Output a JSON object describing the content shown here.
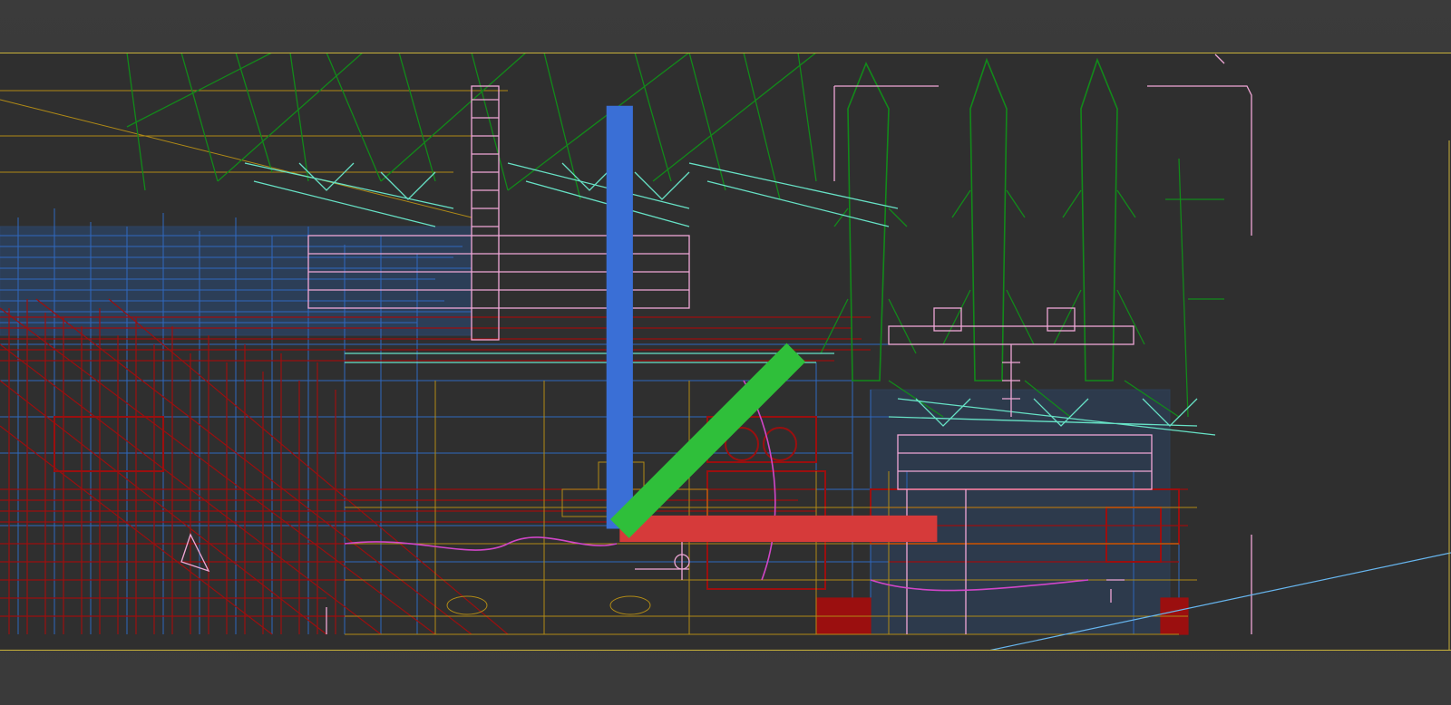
{
  "viewport": {
    "name": "wireframe-viewport",
    "background": "#3a3a3a",
    "frame_color": "#c9b23a"
  },
  "wire_colors": {
    "red": "#9b0f0f",
    "blue": "#2f6fcf",
    "green": "#128a1a",
    "pink": "#f0a7d6",
    "cyan": "#67e2c6",
    "gold": "#b08a16",
    "magenta": "#d146c8",
    "light_blue": "#67b6ef"
  },
  "axis_gizmo": {
    "x_color": "#d63a3a",
    "y_color": "#2fbf3a",
    "z_color": "#3a6fd6"
  }
}
